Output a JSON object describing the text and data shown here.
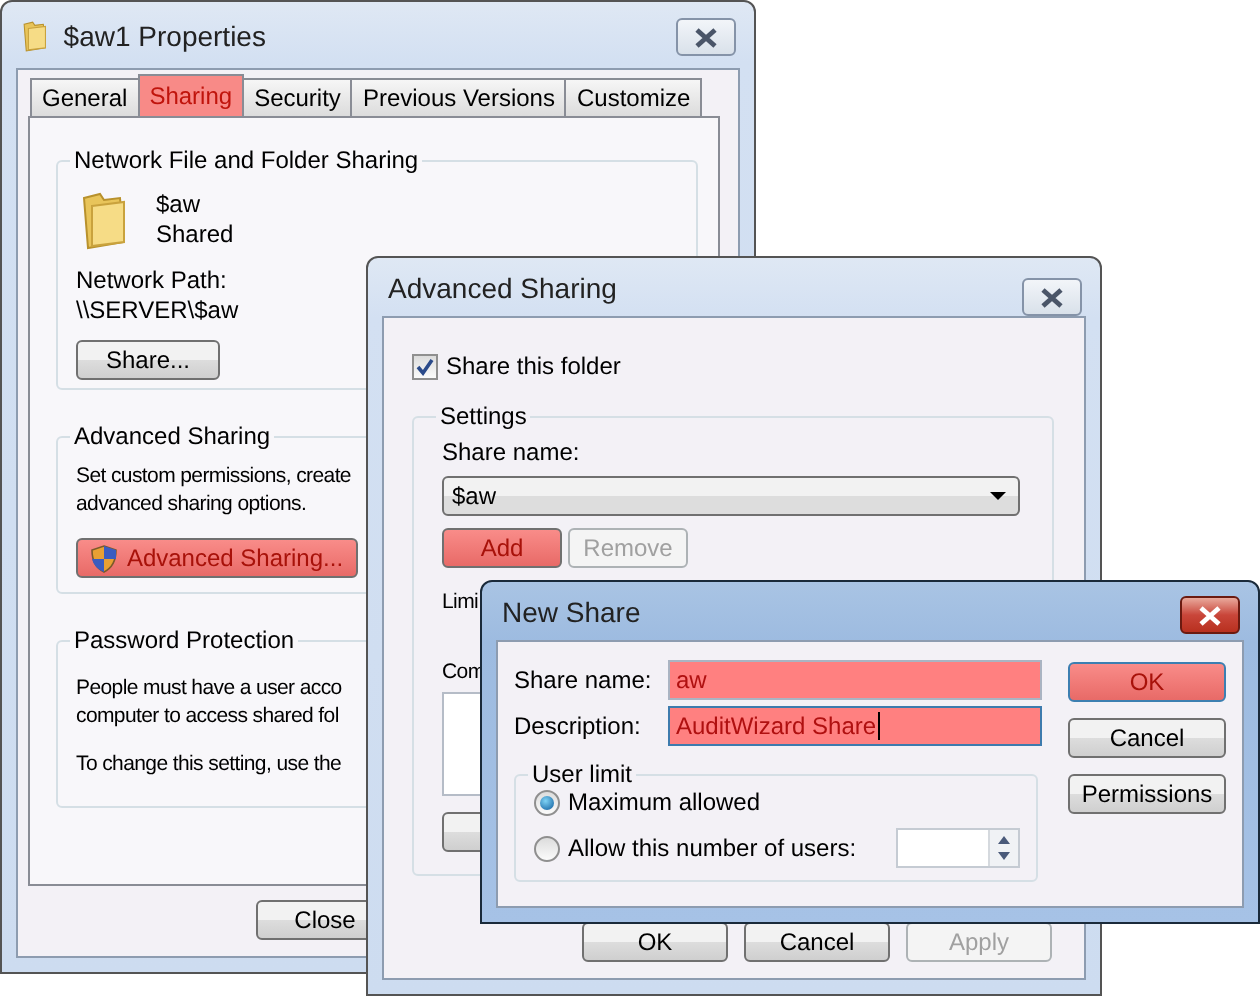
{
  "properties_window": {
    "title": "$aw1 Properties",
    "tabs": [
      {
        "label": "General",
        "selected": false
      },
      {
        "label": "Sharing",
        "selected": true
      },
      {
        "label": "Security",
        "selected": false
      },
      {
        "label": "Previous Versions",
        "selected": false
      },
      {
        "label": "Customize",
        "selected": false
      }
    ],
    "network_sharing": {
      "heading": "Network File and Folder Sharing",
      "name": "$aw",
      "status": "Shared",
      "path_label": "Network Path:",
      "path": "\\\\SERVER\\$aw",
      "button": "Share..."
    },
    "advanced_sharing": {
      "heading": "Advanced Sharing",
      "lines": [
        "Set custom permissions, create",
        "advanced sharing options."
      ],
      "button": {
        "label": "Advanced Sharing...",
        "highlighted": true
      }
    },
    "password_protection": {
      "heading": "Password Protection",
      "lines": [
        "People must have a user acco",
        "computer to access shared fol"
      ],
      "note": "To change this setting, use the"
    },
    "buttons": [
      "Close"
    ]
  },
  "advanced_sharing_window": {
    "title": "Advanced Sharing",
    "share_this_folder": {
      "label": "Share this folder",
      "checked": true
    },
    "settings": {
      "heading": "Settings",
      "share_name_label": "Share name:",
      "share_name": "$aw",
      "buttons": [
        {
          "label": "Add",
          "highlighted": true,
          "disabled": false
        },
        {
          "label": "Remove",
          "highlighted": false,
          "disabled": true
        }
      ],
      "limit_label": "Limi",
      "comments_label": "Com"
    },
    "buttons": [
      {
        "label": "OK",
        "disabled": false
      },
      {
        "label": "Cancel",
        "disabled": false
      },
      {
        "label": "Apply",
        "disabled": true
      }
    ]
  },
  "new_share_window": {
    "title": "New Share",
    "fields": [
      {
        "label": "Share name:",
        "value": "aw",
        "highlighted": true,
        "focused": false
      },
      {
        "label": "Description:",
        "value": "AuditWizard Share",
        "highlighted": true,
        "focused": true
      }
    ],
    "user_limit": {
      "heading": "User limit",
      "options": [
        {
          "label": "Maximum allowed",
          "selected": true
        },
        {
          "label": "Allow this number of users:",
          "selected": false
        }
      ]
    },
    "buttons": [
      {
        "label": "OK",
        "highlighted": true
      },
      {
        "label": "Cancel",
        "highlighted": false
      },
      {
        "label": "Permissions",
        "highlighted": false
      }
    ]
  }
}
